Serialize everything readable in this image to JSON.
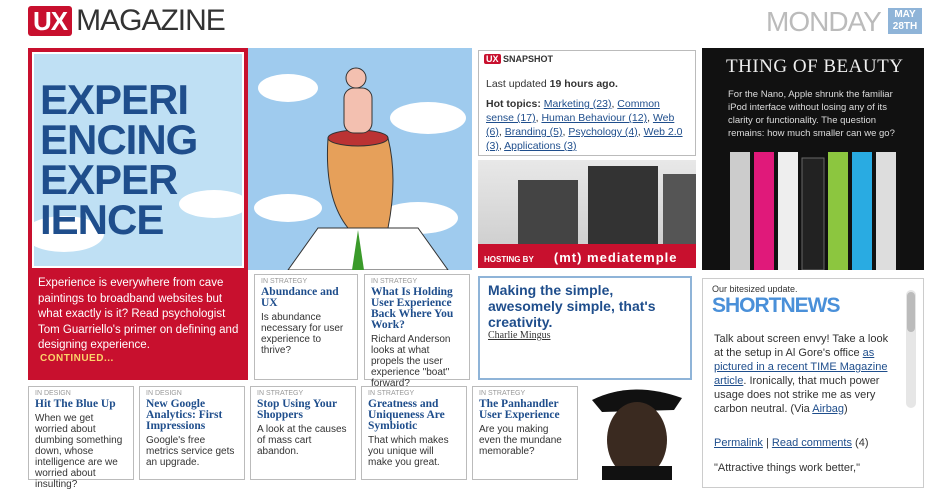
{
  "header": {
    "logo_badge": "UX",
    "logo_word": "MAGAZINE",
    "day": "MONDAY",
    "date_month": "MAY",
    "date_day": "28TH"
  },
  "hero": {
    "title_lines": [
      "EXPERI",
      "ENCING",
      "EXPER",
      "IENCE"
    ],
    "text": "Experience is everywhere from cave paintings to broadband websites but what exactly is it? Read psychologist Tom Guarriello's primer on defining and designing experience.",
    "more": "CONTINUED..."
  },
  "cards": [
    {
      "cat": "IN STRATEGY",
      "title": "Abundance and UX",
      "desc": "Is abundance necessary for user experience to thrive?"
    },
    {
      "cat": "IN STRATEGY",
      "title": "What Is Holding User Experience Back Where You Work?",
      "desc": "Richard Anderson looks at what propels the user experience \"boat\" forward?"
    },
    {
      "cat": "IN DESIGN",
      "title": "Hit The Blue Up",
      "desc": "When we get worried about dumbing something down, whose intelligence are we worried about insulting?"
    },
    {
      "cat": "IN DESIGN",
      "title": "New Google Analytics: First Impressions",
      "desc": "Google's free metrics service gets an upgrade."
    },
    {
      "cat": "IN STRATEGY",
      "title": "Stop Using Your Shoppers",
      "desc": "A look at the causes of mass cart abandon."
    },
    {
      "cat": "IN STRATEGY",
      "title": "Greatness and Uniqueness Are Symbiotic",
      "desc": "That which makes you unique will make you great."
    },
    {
      "cat": "IN STRATEGY",
      "title": "The Panhandler User Experience",
      "desc": "Are you making even the mundane memorable?"
    }
  ],
  "snapshot": {
    "badge": "UX",
    "label": "SNAPSHOT",
    "updated_prefix": "Last updated ",
    "updated_value": "19 hours ago.",
    "topics_label": "Hot topics:",
    "topics": [
      "Marketing (23)",
      "Common sense (17)",
      "Human Behaviour (12)",
      "Web (6)",
      "Branding (5)",
      "Psychology (4)",
      "Web 2.0 (3)",
      "Applications (3)"
    ]
  },
  "ad": {
    "hosting_label": "HOSTING BY",
    "brand": "(mt) mediatemple"
  },
  "beauty": {
    "title": "THING OF BEAUTY",
    "text": "For the Nano, Apple shrunk the familiar iPod interface without losing any of its clarity or functionality. The question remains: how much smaller can we go?"
  },
  "quote": {
    "text": "Making the simple, awesomely simple, that's creativity.",
    "author": "Charlie Mingus"
  },
  "shortnews": {
    "subtitle": "Our bitesized update.",
    "title": "SHORTNEWS",
    "body_1": "Talk about screen envy! Take a look at the setup in Al Gore's office ",
    "body_link": "as pictured in a recent TIME Magazine article",
    "body_2": ". Ironically, that much power usage does not strike me as very carbon neutral. (Via ",
    "via_link": "Airbag",
    "body_3": ")",
    "permalink": "Permalink",
    "comments": "Read comments",
    "comments_count": "(4)",
    "next_quote": "\"Attractive things work better,\""
  },
  "colors": {
    "brand_red": "#c8102e",
    "link_blue": "#1f4e8c",
    "accent_blue": "#4a90d9"
  }
}
